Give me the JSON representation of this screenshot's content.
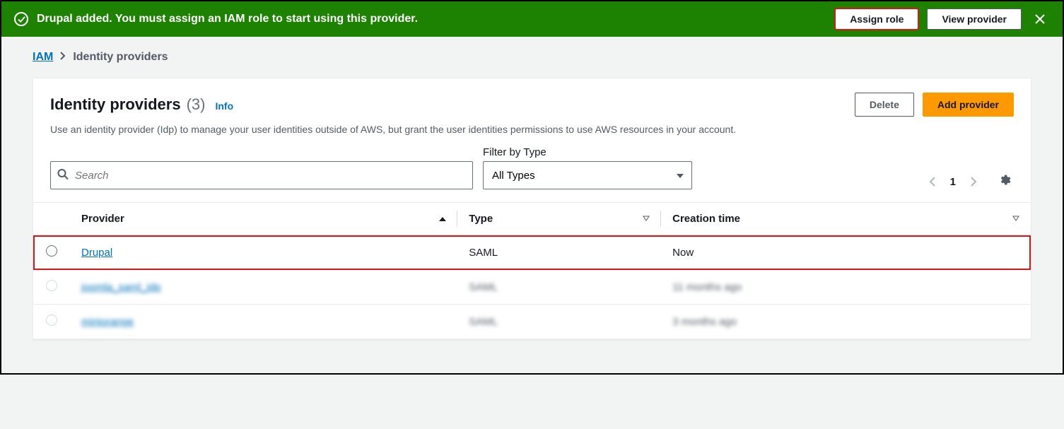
{
  "banner": {
    "message": "Drupal added. You must assign an IAM role to start using this provider.",
    "assign_label": "Assign role",
    "view_label": "View provider"
  },
  "breadcrumbs": {
    "root": "IAM",
    "current": "Identity providers"
  },
  "header": {
    "title": "Identity providers",
    "count": "(3)",
    "info": "Info",
    "description": "Use an identity provider (Idp) to manage your user identities outside of AWS, but grant the user identities permissions to use AWS resources in your account.",
    "delete_label": "Delete",
    "add_label": "Add provider"
  },
  "search": {
    "placeholder": "Search"
  },
  "filter": {
    "label": "Filter by Type",
    "selected": "All Types"
  },
  "pager": {
    "page": "1"
  },
  "table": {
    "cols": {
      "provider": "Provider",
      "type": "Type",
      "creation": "Creation time"
    },
    "rows": [
      {
        "provider": "Drupal",
        "type": "SAML",
        "creation": "Now",
        "highlighted": true
      },
      {
        "provider": "joomla_saml_idp",
        "type": "SAML",
        "creation": "11 months ago",
        "blurred": true
      },
      {
        "provider": "miniorange",
        "type": "SAML",
        "creation": "3 months ago",
        "blurred": true
      }
    ]
  }
}
